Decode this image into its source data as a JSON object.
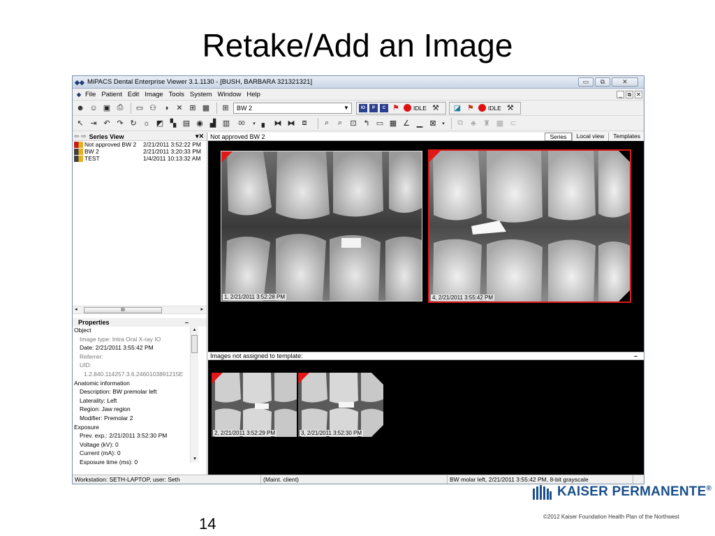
{
  "slide": {
    "title": "Retake/Add an Image",
    "number": "14",
    "logo_text": "KAISER PERMANENTE",
    "logo_mark": "®",
    "copyright": "©2012 Kaiser Foundation Health Plan of the Northwest"
  },
  "window": {
    "title": "MiPACS Dental Enterprise Viewer 3.1.1130 - [BUSH, BARBARA  321321321]",
    "minimize": "▭",
    "restore": "⧉",
    "close": "✕"
  },
  "menu": [
    "File",
    "Patient",
    "Edit",
    "Image",
    "Tools",
    "System",
    "Window",
    "Help"
  ],
  "mdi_controls": [
    "_",
    "⧉",
    "✕"
  ],
  "toolbar": {
    "template_combo": "BW 2",
    "idle_label_1": "IDLE",
    "idle_label_2": "IDLE",
    "sq_io": "IO",
    "sq_p": "P",
    "sq_c": "C",
    "zoom_combo": "00"
  },
  "series_view": {
    "title": "Series View",
    "items": [
      {
        "name": "Not approved BW 2",
        "date": "2/21/2011 3:52:22 PM",
        "icon": "series-red-icon"
      },
      {
        "name": "BW 2",
        "date": "2/21/2011 3:20:33 PM",
        "icon": "series-icon"
      },
      {
        "name": "TEST",
        "date": "1/4/2011 10:13:32 AM",
        "icon": "series-icon"
      }
    ],
    "scroll_thumb": "III"
  },
  "properties": {
    "title": "Properties",
    "collapse": "–",
    "rows": [
      {
        "text": "Object",
        "level": 0,
        "grey": false
      },
      {
        "text": "Image type: Intra Oral X-ray IO",
        "level": 1,
        "grey": true
      },
      {
        "text": "Date: 2/21/2011 3:55:42 PM",
        "level": 1,
        "grey": false
      },
      {
        "text": "Referrer:",
        "level": 1,
        "grey": true
      },
      {
        "text": "UID:",
        "level": 1,
        "grey": true
      },
      {
        "text": "1.2.840.114257.3.6.2460103891215E",
        "level": 2,
        "grey": true
      },
      {
        "text": "Anatomic information",
        "level": 0,
        "grey": false
      },
      {
        "text": "Description: BW premolar left",
        "level": 1,
        "grey": false
      },
      {
        "text": "Laterality: Left",
        "level": 1,
        "grey": false
      },
      {
        "text": "Region: Jaw region",
        "level": 1,
        "grey": false
      },
      {
        "text": "Modifier: Premolar 2",
        "level": 1,
        "grey": false
      },
      {
        "text": "Exposure",
        "level": 0,
        "grey": false
      },
      {
        "text": "Prev. exp.: 2/21/2011 3:52:30 PM",
        "level": 1,
        "grey": false
      },
      {
        "text": "Voltage (kV): 0",
        "level": 1,
        "grey": false
      },
      {
        "text": "Current (mA): 0",
        "level": 1,
        "grey": false
      },
      {
        "text": "Exposure time (ms): 0",
        "level": 1,
        "grey": false
      }
    ]
  },
  "main": {
    "header": "Not approved BW 2",
    "tabs": [
      "Series",
      "Local view",
      "Templates"
    ],
    "active_tab": "Series",
    "images": [
      {
        "label": "1, 2/21/2011 3:52:28 PM"
      },
      {
        "label": "4, 2/21/2011 3:55:42 PM"
      }
    ],
    "unassigned_header": "Images not assigned to template:",
    "unassigned_collapse": "–",
    "thumbs": [
      {
        "label": "2, 2/21/2011 3:52:29 PM"
      },
      {
        "label": "3, 2/21/2011 3:52:30 PM"
      }
    ]
  },
  "statusbar": {
    "workstation": "Workstation: SETH-LAPTOP, user: Seth",
    "client": "(Maint. client)",
    "image_info": "BW molar left, 2/21/2011 3:55:42 PM, 8-bit grayscale"
  },
  "colors": {
    "accent_red": "#e01818",
    "kp_blue": "#1a4f8b"
  }
}
